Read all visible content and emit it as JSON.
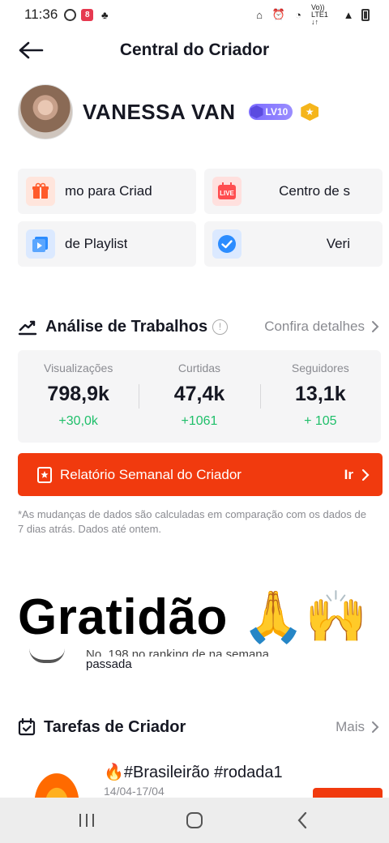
{
  "status_bar": {
    "time": "11:36",
    "network_label": "Vo)) LTE1 ↓↑"
  },
  "header": {
    "title": "Central do Criador"
  },
  "profile": {
    "name": "VANESSA VAN",
    "level_badge": "LV10"
  },
  "tools": [
    {
      "label": "mo para Criad",
      "icon": "gift-icon",
      "color": "#ff5a2a"
    },
    {
      "label": "Centro de s",
      "icon": "live-calendar-icon",
      "color": "#ff4d4f"
    },
    {
      "label": "de Playlist",
      "icon": "playlist-icon",
      "color": "#2b8cff"
    },
    {
      "label": "Veri",
      "icon": "verified-icon",
      "color": "#2b8cff"
    }
  ],
  "analysis": {
    "title": "Análise de Trabalhos",
    "link": "Confira detalhes",
    "stats": [
      {
        "label": "Visualizações",
        "value": "798,9k",
        "delta": "+30,0k"
      },
      {
        "label": "Curtidas",
        "value": "47,4k",
        "delta": "+1061"
      },
      {
        "label": "Seguidores",
        "value": "13,1k",
        "delta": "+ 105"
      }
    ]
  },
  "report": {
    "label": "Relatório Semanal do Criador",
    "action": "Ir"
  },
  "footnote": "*As mudanças de dados são calculadas em comparação com os dados de 7 dias atrás. Dados até ontem.",
  "overlay": {
    "text": "Gratidão 🙏🙌"
  },
  "ranking": {
    "line1": "No. 198 no ranking de na semana",
    "line2": "passada"
  },
  "tasks": {
    "title": "Tarefas de Criador",
    "link": "Mais",
    "item_title": "🔥#Brasileirão #rodada1",
    "item_date": "14/04-17/04"
  },
  "colors": {
    "accent": "#f13a0e",
    "positive": "#1fbf6a",
    "muted": "#8a8b91"
  }
}
